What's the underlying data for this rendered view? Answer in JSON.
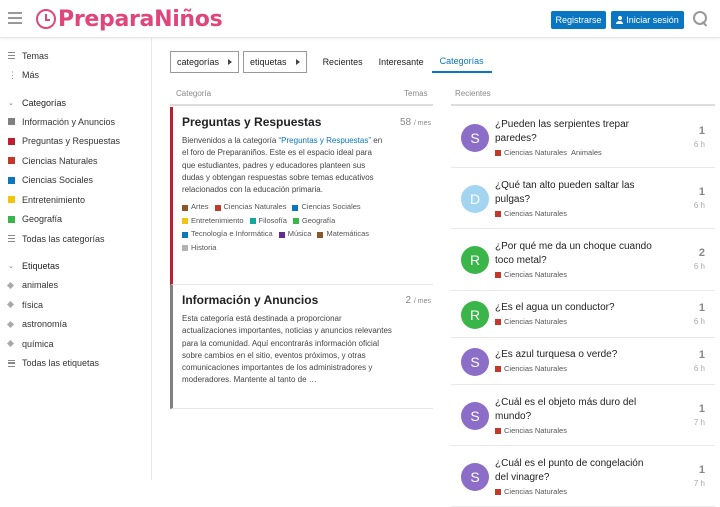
{
  "header": {
    "logo_text": "PreparaNiños",
    "register_label": "Registrarse",
    "login_label": "Iniciar sesión",
    "brand_color": "#e0457b",
    "accent_color": "#0a76c2"
  },
  "sidebar": {
    "top_items": [
      {
        "label": "Temas",
        "icon": "topics-list-icon"
      },
      {
        "label": "Más",
        "icon": "more-vertical-icon"
      }
    ],
    "categories_header": "Categorías",
    "categories": [
      {
        "label": "Información y Anuncios",
        "color": "#808080"
      },
      {
        "label": "Preguntas y Respuestas",
        "color": "#bf1e2e"
      },
      {
        "label": "Ciencias Naturales",
        "color": "#c0392b"
      },
      {
        "label": "Ciencias Sociales",
        "color": "#0e76bd"
      },
      {
        "label": "Entretenimiento",
        "color": "#f1c40f"
      },
      {
        "label": "Geografía",
        "color": "#3ab54a"
      },
      {
        "label": "Todas las categorías",
        "color": ""
      }
    ],
    "tags_header": "Etiquetas",
    "tags": [
      {
        "label": "animales"
      },
      {
        "label": "física"
      },
      {
        "label": "astronomía"
      },
      {
        "label": "química"
      },
      {
        "label": "Todas las etiquetas"
      }
    ]
  },
  "nav": {
    "categories_dropdown": "categorías",
    "tags_dropdown": "etiquetas",
    "tabs": [
      "Recientes",
      "Interesante",
      "Categorías"
    ],
    "active_tab": "Categorías"
  },
  "columns": {
    "category": "Categoría",
    "topics": "Temas",
    "recent": "Recientes"
  },
  "categories": [
    {
      "title": "Preguntas y Respuestas",
      "count": "58",
      "period": "/ mes",
      "color": "#bf1e2e",
      "desc_before": "Bienvenidos a la categoría ",
      "desc_link": "“Preguntas y Respuestas”",
      "desc_after": " en el foro de Preparaniños. Este es el espacio ideal para que estudiantes, padres y educadores planteen sus dudas y obtengan respuestas sobre temas educativos relacionados con la educación primaria.",
      "subcategories": [
        {
          "label": "Artes",
          "color": "#8b572a"
        },
        {
          "label": "Ciencias Naturales",
          "color": "#c0392b"
        },
        {
          "label": "Ciencias Sociales",
          "color": "#0e76bd"
        },
        {
          "label": "Entretenimiento",
          "color": "#f1c40f"
        },
        {
          "label": "Filosofía",
          "color": "#12a89d"
        },
        {
          "label": "Geografía",
          "color": "#3ab54a"
        },
        {
          "label": "Tecnología e Informática",
          "color": "#0e76bd"
        },
        {
          "label": "Música",
          "color": "#652d90"
        },
        {
          "label": "Matemáticas",
          "color": "#8b572a"
        },
        {
          "label": "Historia",
          "color": "#b3b3b3"
        }
      ]
    },
    {
      "title": "Información y Anuncios",
      "count": "2",
      "period": "/ mes",
      "color": "#808080",
      "desc": "Esta categoría está destinada a proporcionar actualizaciones importantes, noticias y anuncios relevantes para la comunidad. Aquí encontrarás información oficial sobre cambios en el sitio, eventos próximos, y otras comunicaciones importantes de los administradores y moderadores. Mantente al tanto de …"
    }
  ],
  "recent_topics": [
    {
      "avatar": "S",
      "avatar_color": "#8c6dc8",
      "title": "¿Pueden las serpientes trepar paredes?",
      "category": "Ciencias Naturales",
      "tag": "Animales",
      "count": "1",
      "age": "6 h"
    },
    {
      "avatar": "D",
      "avatar_color": "#a3d4f0",
      "title": "¿Qué tan alto pueden saltar las pulgas?",
      "category": "Ciencias Naturales",
      "count": "1",
      "age": "6 h"
    },
    {
      "avatar": "R",
      "avatar_color": "#3ab54a",
      "title": "¿Por qué me da un choque cuando toco metal?",
      "category": "Ciencias Naturales",
      "count": "2",
      "age": "6 h"
    },
    {
      "avatar": "R",
      "avatar_color": "#3ab54a",
      "title": "¿Es el agua un conductor?",
      "category": "Ciencias Naturales",
      "count": "1",
      "age": "6 h"
    },
    {
      "avatar": "S",
      "avatar_color": "#8c6dc8",
      "title": "¿Es azul turquesa o verde?",
      "category": "Ciencias Naturales",
      "count": "1",
      "age": "6 h"
    },
    {
      "avatar": "S",
      "avatar_color": "#8c6dc8",
      "title": "¿Cuál es el objeto más duro del mundo?",
      "category": "Ciencias Naturales",
      "count": "1",
      "age": "7 h"
    },
    {
      "avatar": "S",
      "avatar_color": "#8c6dc8",
      "title": "¿Cuál es el punto de congelación del vinagre?",
      "category": "Ciencias Naturales",
      "count": "1",
      "age": "7 h"
    }
  ]
}
